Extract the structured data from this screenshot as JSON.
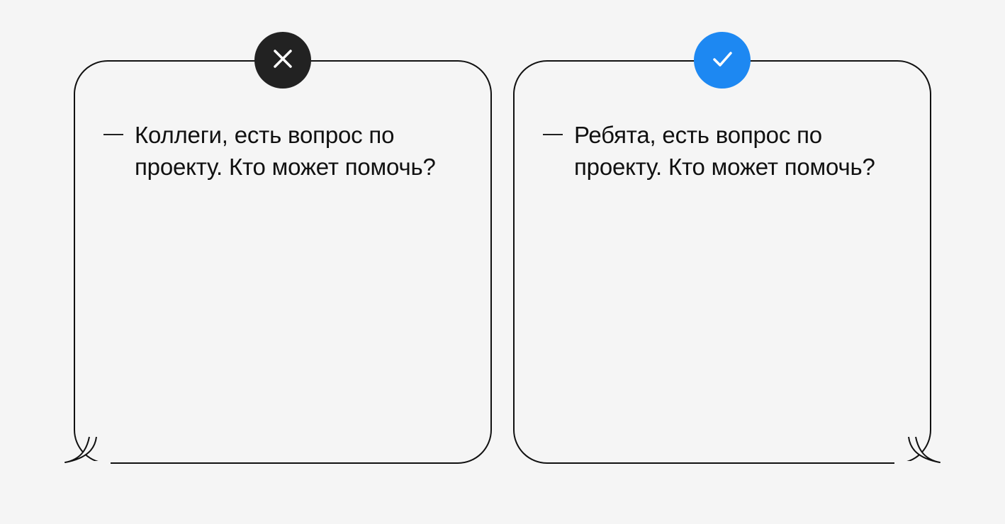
{
  "cards": {
    "wrong": {
      "badge_icon": "x-icon",
      "text": "Коллеги, есть вопрос по проекту. Кто может помочь?"
    },
    "correct": {
      "badge_icon": "check-icon",
      "text": "Ребята, есть вопрос по проекту. Кто может помочь?"
    }
  },
  "colors": {
    "badge_wrong_bg": "#222222",
    "badge_correct_bg": "#1d88f2",
    "page_bg": "#f5f5f5",
    "stroke": "#111111"
  }
}
